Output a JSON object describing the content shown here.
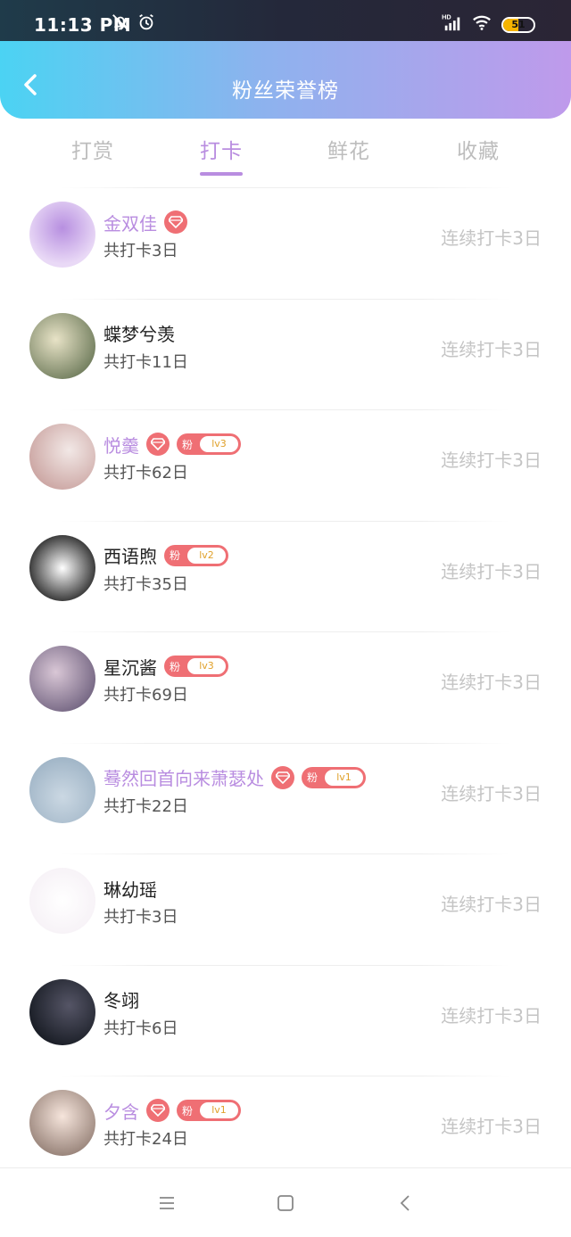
{
  "status_bar": {
    "time": "11:13 PM",
    "icons": [
      "bell-off-icon",
      "alarm-icon",
      "hd-signal-icon",
      "wifi-icon"
    ],
    "battery_text": "51",
    "battery_level": 0.51
  },
  "header": {
    "title": "粉丝荣誉榜",
    "back_icon": "chevron-left-icon",
    "gradient": [
      "#4bd3f3",
      "#bf9aeb"
    ]
  },
  "tabs": [
    {
      "label": "打赏",
      "active": false
    },
    {
      "label": "打卡",
      "active": true
    },
    {
      "label": "鲜花",
      "active": false
    },
    {
      "label": "收藏",
      "active": false
    }
  ],
  "fan_badge_label": "粉",
  "entries": [
    {
      "name": "金双佳",
      "vip": true,
      "gem": true,
      "fan_level": "",
      "total": "共打卡3日",
      "streak": "连续打卡3日"
    },
    {
      "name": "蝶梦兮羡",
      "vip": false,
      "gem": false,
      "fan_level": "",
      "total": "共打卡11日",
      "streak": "连续打卡3日"
    },
    {
      "name": "悦羹",
      "vip": true,
      "gem": true,
      "fan_level": "lv3",
      "total": "共打卡62日",
      "streak": "连续打卡3日"
    },
    {
      "name": "西语煦",
      "vip": false,
      "gem": false,
      "fan_level": "lv2",
      "total": "共打卡35日",
      "streak": "连续打卡3日"
    },
    {
      "name": "星沉酱",
      "vip": false,
      "gem": false,
      "fan_level": "lv3",
      "total": "共打卡69日",
      "streak": "连续打卡3日"
    },
    {
      "name": "蓦然回首向来萧瑟处",
      "vip": true,
      "gem": true,
      "fan_level": "lv1",
      "total": "共打卡22日",
      "streak": "连续打卡3日"
    },
    {
      "name": "琳幼瑶",
      "vip": false,
      "gem": false,
      "fan_level": "",
      "total": "共打卡3日",
      "streak": "连续打卡3日"
    },
    {
      "name": "冬翊",
      "vip": false,
      "gem": false,
      "fan_level": "",
      "total": "共打卡6日",
      "streak": "连续打卡3日"
    },
    {
      "name": "夕含",
      "vip": true,
      "gem": true,
      "fan_level": "lv1",
      "total": "共打卡24日",
      "streak": "连续打卡3日"
    }
  ],
  "colors": {
    "accent_purple": "#b98de0",
    "badge_red": "#ef6f74",
    "level_text": "#e0a12a",
    "muted_text": "#c4c4c4"
  },
  "nav_bar": [
    "menu-icon",
    "home-square-icon",
    "back-triangle-icon"
  ]
}
